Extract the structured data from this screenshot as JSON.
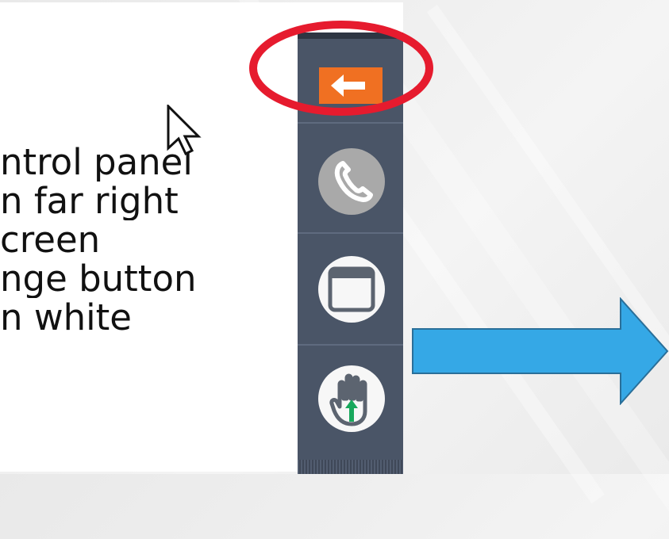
{
  "text_list": {
    "line1": "ntrol panel",
    "line2": "n far right",
    "line3": "creen",
    "line4": "nge button",
    "line5": "n white"
  },
  "control_panel": {
    "buttons": [
      {
        "name": "collapse-button",
        "icon": "arrow-left-icon"
      },
      {
        "name": "phone-button",
        "icon": "phone-icon"
      },
      {
        "name": "window-button",
        "icon": "window-icon"
      },
      {
        "name": "raise-hand-button",
        "icon": "raise-hand-icon"
      }
    ]
  },
  "colors": {
    "panel": "#4a5567",
    "collapse_button": "#f07022",
    "highlight_ellipse": "#e61b2e",
    "arrow": "#35a8e6",
    "hand_arrow": "#18a85c"
  },
  "annotations": [
    {
      "name": "highlight-ellipse",
      "color": "red",
      "target": "collapse-button"
    },
    {
      "name": "blue-arrow",
      "color": "blue",
      "direction": "right"
    }
  ]
}
